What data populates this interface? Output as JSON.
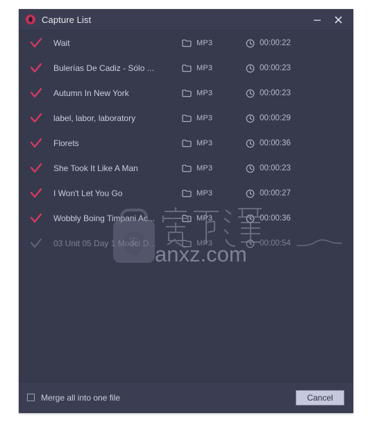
{
  "window": {
    "title": "Capture List",
    "app_icon": "app-logo-icon",
    "controls": {
      "minimize": "minimize-icon",
      "close": "close-icon"
    },
    "colors": {
      "window_bg": "#373a4d",
      "titlebar_bg": "#3b3e52",
      "footer_bg": "#3b3e52",
      "check_accent": "#d13a63",
      "check_disabled": "#6e7287",
      "text_primary": "#c9ccdb",
      "text_secondary": "#b6bacb",
      "button_bg": "#c6c9dd",
      "button_text": "#2c2f41"
    }
  },
  "list": {
    "format_icon": "folder-icon",
    "duration_icon": "clock-icon",
    "check_icon": "checkmark-icon",
    "rows": [
      {
        "name": "Wait",
        "format": "MP3",
        "duration": "00:00:22",
        "checked": true,
        "enabled": true,
        "waveform": false
      },
      {
        "name": "Bulerías De Cadiz - Sólo ...",
        "format": "MP3",
        "duration": "00:00:23",
        "checked": true,
        "enabled": true,
        "waveform": false
      },
      {
        "name": "Autumn In New York",
        "format": "MP3",
        "duration": "00:00:23",
        "checked": true,
        "enabled": true,
        "waveform": false
      },
      {
        "name": "label, labor, laboratory",
        "format": "MP3",
        "duration": "00:00:29",
        "checked": true,
        "enabled": true,
        "waveform": false
      },
      {
        "name": "Florets",
        "format": "MP3",
        "duration": "00:00:36",
        "checked": true,
        "enabled": true,
        "waveform": false
      },
      {
        "name": "She Took It Like A Man",
        "format": "MP3",
        "duration": "00:00:23",
        "checked": true,
        "enabled": true,
        "waveform": false
      },
      {
        "name": "I Won't Let You Go",
        "format": "MP3",
        "duration": "00:00:27",
        "checked": true,
        "enabled": true,
        "waveform": false
      },
      {
        "name": "Wobbly Boing Timpani Ac...",
        "format": "MP3",
        "duration": "00:00:36",
        "checked": true,
        "enabled": true,
        "waveform": false
      },
      {
        "name": "03 Unit 05 Day  1 Model D...",
        "format": "MP3",
        "duration": "00:00:54",
        "checked": true,
        "enabled": false,
        "waveform": true
      }
    ]
  },
  "footer": {
    "merge_checkbox_label": "Merge all into one file",
    "merge_checked": false,
    "cancel_label": "Cancel"
  },
  "watermark": {
    "site": "anxz.com",
    "characters": "安下载",
    "logo": "briefcase-shield-icon"
  }
}
